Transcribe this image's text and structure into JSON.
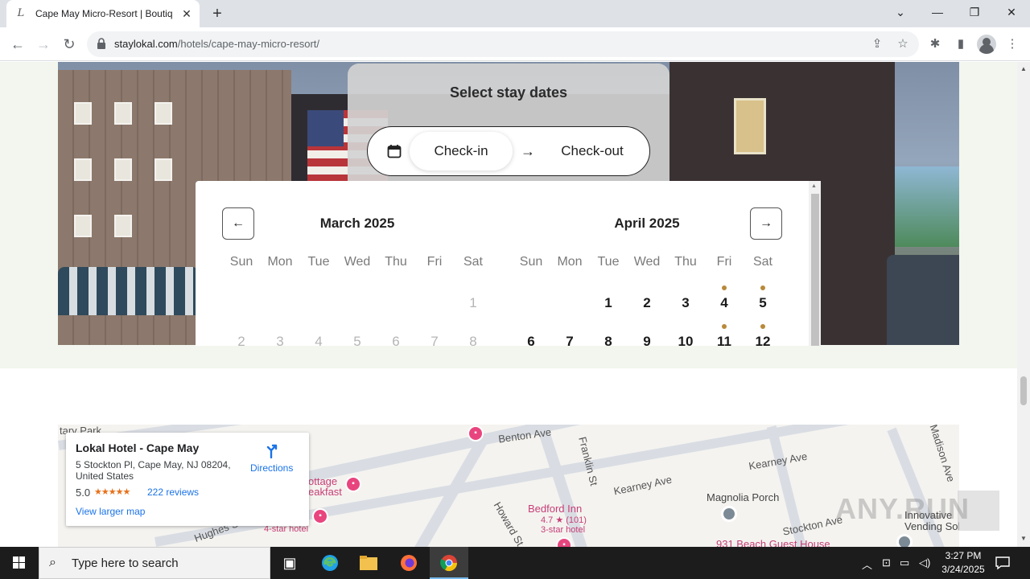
{
  "browser": {
    "tab": {
      "favicon": "L",
      "title": "Cape May Micro-Resort | Boutiq",
      "close": "✕"
    },
    "new_tab": "+",
    "window_controls": {
      "tabs_menu": "⌄",
      "minimize": "—",
      "restore": "❐",
      "close": "✕"
    },
    "nav": {
      "back": "←",
      "forward": "→",
      "reload": "↻"
    },
    "url_host": "staylokal.com",
    "url_path": "/hotels/cape-may-micro-resort/",
    "icons": {
      "share": "⇪",
      "bookmark": "☆",
      "extensions": "✱",
      "side_panel": "▮",
      "menu": "⋮"
    }
  },
  "date_picker": {
    "title": "Select stay dates",
    "check_in": "Check-in",
    "arrow": "→",
    "check_out": "Check-out"
  },
  "calendar": {
    "prev": "←",
    "next": "→",
    "weekdays": [
      "Sun",
      "Mon",
      "Tue",
      "Wed",
      "Thu",
      "Fri",
      "Sat"
    ],
    "months": [
      {
        "title": "March 2025",
        "rows": [
          [
            {
              "d": ""
            },
            {
              "d": ""
            },
            {
              "d": ""
            },
            {
              "d": ""
            },
            {
              "d": ""
            },
            {
              "d": ""
            },
            {
              "d": "1",
              "s": "past"
            }
          ],
          [
            {
              "d": "2",
              "s": "past"
            },
            {
              "d": "3",
              "s": "past"
            },
            {
              "d": "4",
              "s": "past"
            },
            {
              "d": "5",
              "s": "past"
            },
            {
              "d": "6",
              "s": "past"
            },
            {
              "d": "7",
              "s": "past"
            },
            {
              "d": "8",
              "s": "past"
            }
          ]
        ]
      },
      {
        "title": "April 2025",
        "rows": [
          [
            {
              "d": ""
            },
            {
              "d": ""
            },
            {
              "d": "1",
              "s": "avail"
            },
            {
              "d": "2",
              "s": "avail"
            },
            {
              "d": "3",
              "s": "avail"
            },
            {
              "d": "4",
              "s": "avail",
              "dot": true
            },
            {
              "d": "5",
              "s": "avail",
              "dot": true
            }
          ],
          [
            {
              "d": "6",
              "s": "avail"
            },
            {
              "d": "7",
              "s": "avail"
            },
            {
              "d": "8",
              "s": "avail"
            },
            {
              "d": "9",
              "s": "avail"
            },
            {
              "d": "10",
              "s": "avail"
            },
            {
              "d": "11",
              "s": "avail",
              "dot": true
            },
            {
              "d": "12",
              "s": "avail",
              "dot": true
            }
          ]
        ]
      }
    ],
    "dot_color": "#b8893a"
  },
  "map": {
    "card": {
      "name": "Lokal Hotel - Cape May",
      "address": "5 Stockton Pl, Cape May, NJ 08204, United States",
      "rating": "5.0",
      "stars": "★★★★★",
      "reviews": "222 reviews",
      "directions": "Directions",
      "larger_map": "View larger map"
    },
    "streets": [
      "Benton Ave",
      "Franklin St",
      "Kearney Ave",
      "Kearney Ave",
      "Madison Ave",
      "Stockton Ave",
      "Howard St",
      "Hughes St",
      "tary Park"
    ],
    "pois": {
      "bedford_inn": "Bedford Inn",
      "bedford_rating": "4.7 ★ (101)",
      "bedford_class": "3-star hotel",
      "cottage": "ottage",
      "cottage2": "eakfast",
      "four_star": "4-star hotel",
      "magnolia": "Magnolia Porch",
      "innovative": "Innovative",
      "vending": "Vending Solutic",
      "beach_guest": "931 Beach Guest House"
    }
  },
  "watermark": "ANY.RUN",
  "taskbar": {
    "search_placeholder": "Type here to search",
    "time": "3:27 PM",
    "date": "3/24/2025"
  }
}
